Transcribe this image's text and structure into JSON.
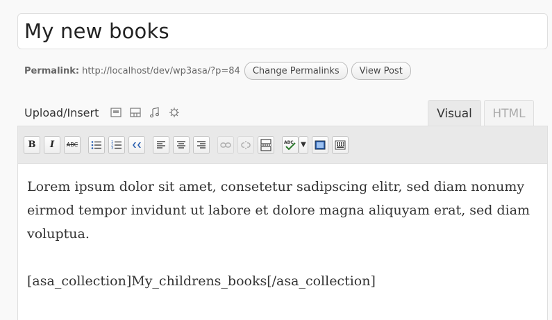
{
  "post": {
    "title": "My new books",
    "permalink_label": "Permalink:",
    "permalink_url": "http://localhost/dev/wp3asa/?p=84",
    "change_permalinks_label": "Change Permalinks",
    "view_post_label": "View Post"
  },
  "media": {
    "label": "Upload/Insert",
    "icons": [
      "image-icon",
      "video-icon",
      "audio-icon",
      "media-icon"
    ]
  },
  "tabs": {
    "visual": "Visual",
    "html": "HTML",
    "active": "visual"
  },
  "toolbar": {
    "bold": "B",
    "italic": "I",
    "strikethrough": "ABC"
  },
  "content": {
    "paragraph1": "Lorem ipsum dolor sit amet, consetetur sadipscing elitr, sed diam nonumy eirmod tempor invidunt ut labore et dolore magna aliquyam erat, sed diam voluptua.",
    "paragraph2": "[asa_collection]My_childrens_books[/asa_collection]"
  },
  "colors": {
    "background": "#f9f9f9",
    "toolbar_bg": "#e9e9e9",
    "border": "#dfdfdf"
  }
}
